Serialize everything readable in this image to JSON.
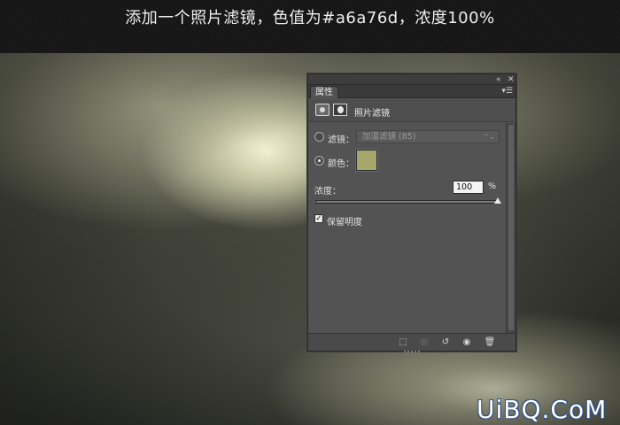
{
  "caption": "添加一个照片滤镜，色值为#a6a76d，浓度100%",
  "panel": {
    "tab_label": "属性",
    "collapse_icon": "double-chevron-left-icon",
    "close_icon": "close-icon",
    "panel_menu_icon": "panel-menu-icon",
    "header_title": "照片滤镜",
    "filter_option_label": "滤镜：",
    "filter_select_value": "加温滤镜 (85)",
    "color_option_label": "颜色：",
    "selected_option": "color",
    "color_value": "#a6a76d",
    "density_label": "浓度：",
    "density_value": "100",
    "density_unit": "%",
    "density_percent": 100,
    "preserve_luminosity_label": "保留明度",
    "preserve_luminosity_checked": true
  },
  "watermark": "UiBQ.CoM",
  "colors": {
    "panel_bg": "#535353",
    "accent_filter_color": "#a6a76d"
  }
}
